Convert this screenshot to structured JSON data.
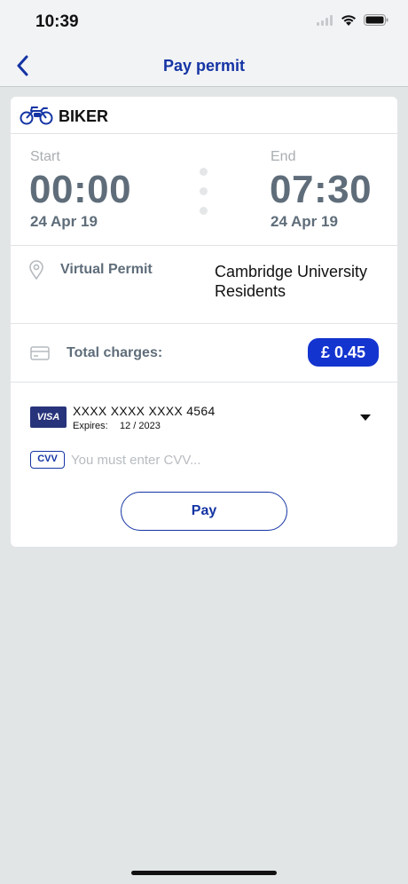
{
  "status_bar": {
    "time": "10:39"
  },
  "nav": {
    "title": "Pay permit"
  },
  "vehicle": {
    "name": "BIKER",
    "icon": "motorbike-icon"
  },
  "session": {
    "start_label": "Start",
    "start_time": "00:00",
    "start_date": "24 Apr 19",
    "end_label": "End",
    "end_time": "07:30",
    "end_date": "24 Apr 19"
  },
  "permit": {
    "type": "Virtual Permit",
    "zone": "Cambridge University Residents"
  },
  "charges": {
    "label": "Total charges:",
    "amount": "£ 0.45"
  },
  "payment_card": {
    "brand": "VISA",
    "number": "XXXX XXXX XXXX 4564",
    "expires_label": "Expires:",
    "expires_value": "12 / 2023"
  },
  "cvv": {
    "badge": "CVV",
    "placeholder": "You must enter CVV..."
  },
  "actions": {
    "pay_label": "Pay"
  },
  "colors": {
    "accent": "#1434a4",
    "price_badge": "#1434d0",
    "background": "#e2e5e6",
    "muted_text": "#5f6d7a"
  }
}
